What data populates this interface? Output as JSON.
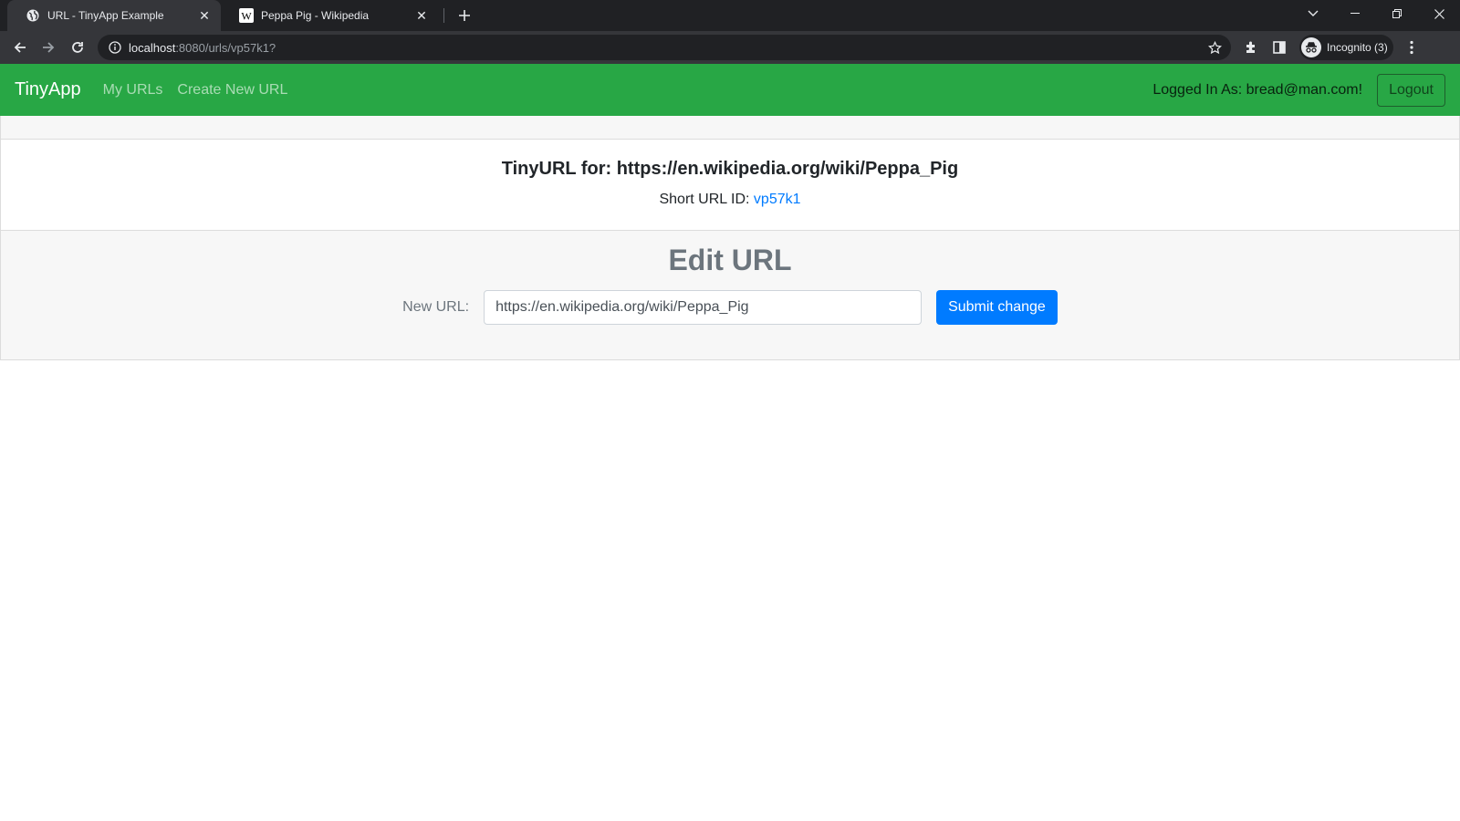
{
  "browser": {
    "tabs": [
      {
        "title": "URL - TinyApp Example",
        "favicon": "globe-icon",
        "active": true
      },
      {
        "title": "Peppa Pig - Wikipedia",
        "favicon": "wikipedia-icon",
        "active": false
      }
    ],
    "address": {
      "host": "localhost",
      "path": ":8080/urls/vp57k1?"
    },
    "profile_label": "Incognito (3)"
  },
  "navbar": {
    "brand": "TinyApp",
    "links": [
      "My URLs",
      "Create New URL"
    ],
    "logged_in_text": "Logged In As: bread@man.com!",
    "logout_label": "Logout",
    "color": "#28a745"
  },
  "card": {
    "title": "TinyURL for: https://en.wikipedia.org/wiki/Peppa_Pig",
    "short_id_label": "Short URL ID: ",
    "short_id": "vp57k1",
    "edit_heading": "Edit URL",
    "form": {
      "label": "New URL:",
      "value": "https://en.wikipedia.org/wiki/Peppa_Pig",
      "submit_label": "Submit change"
    }
  }
}
